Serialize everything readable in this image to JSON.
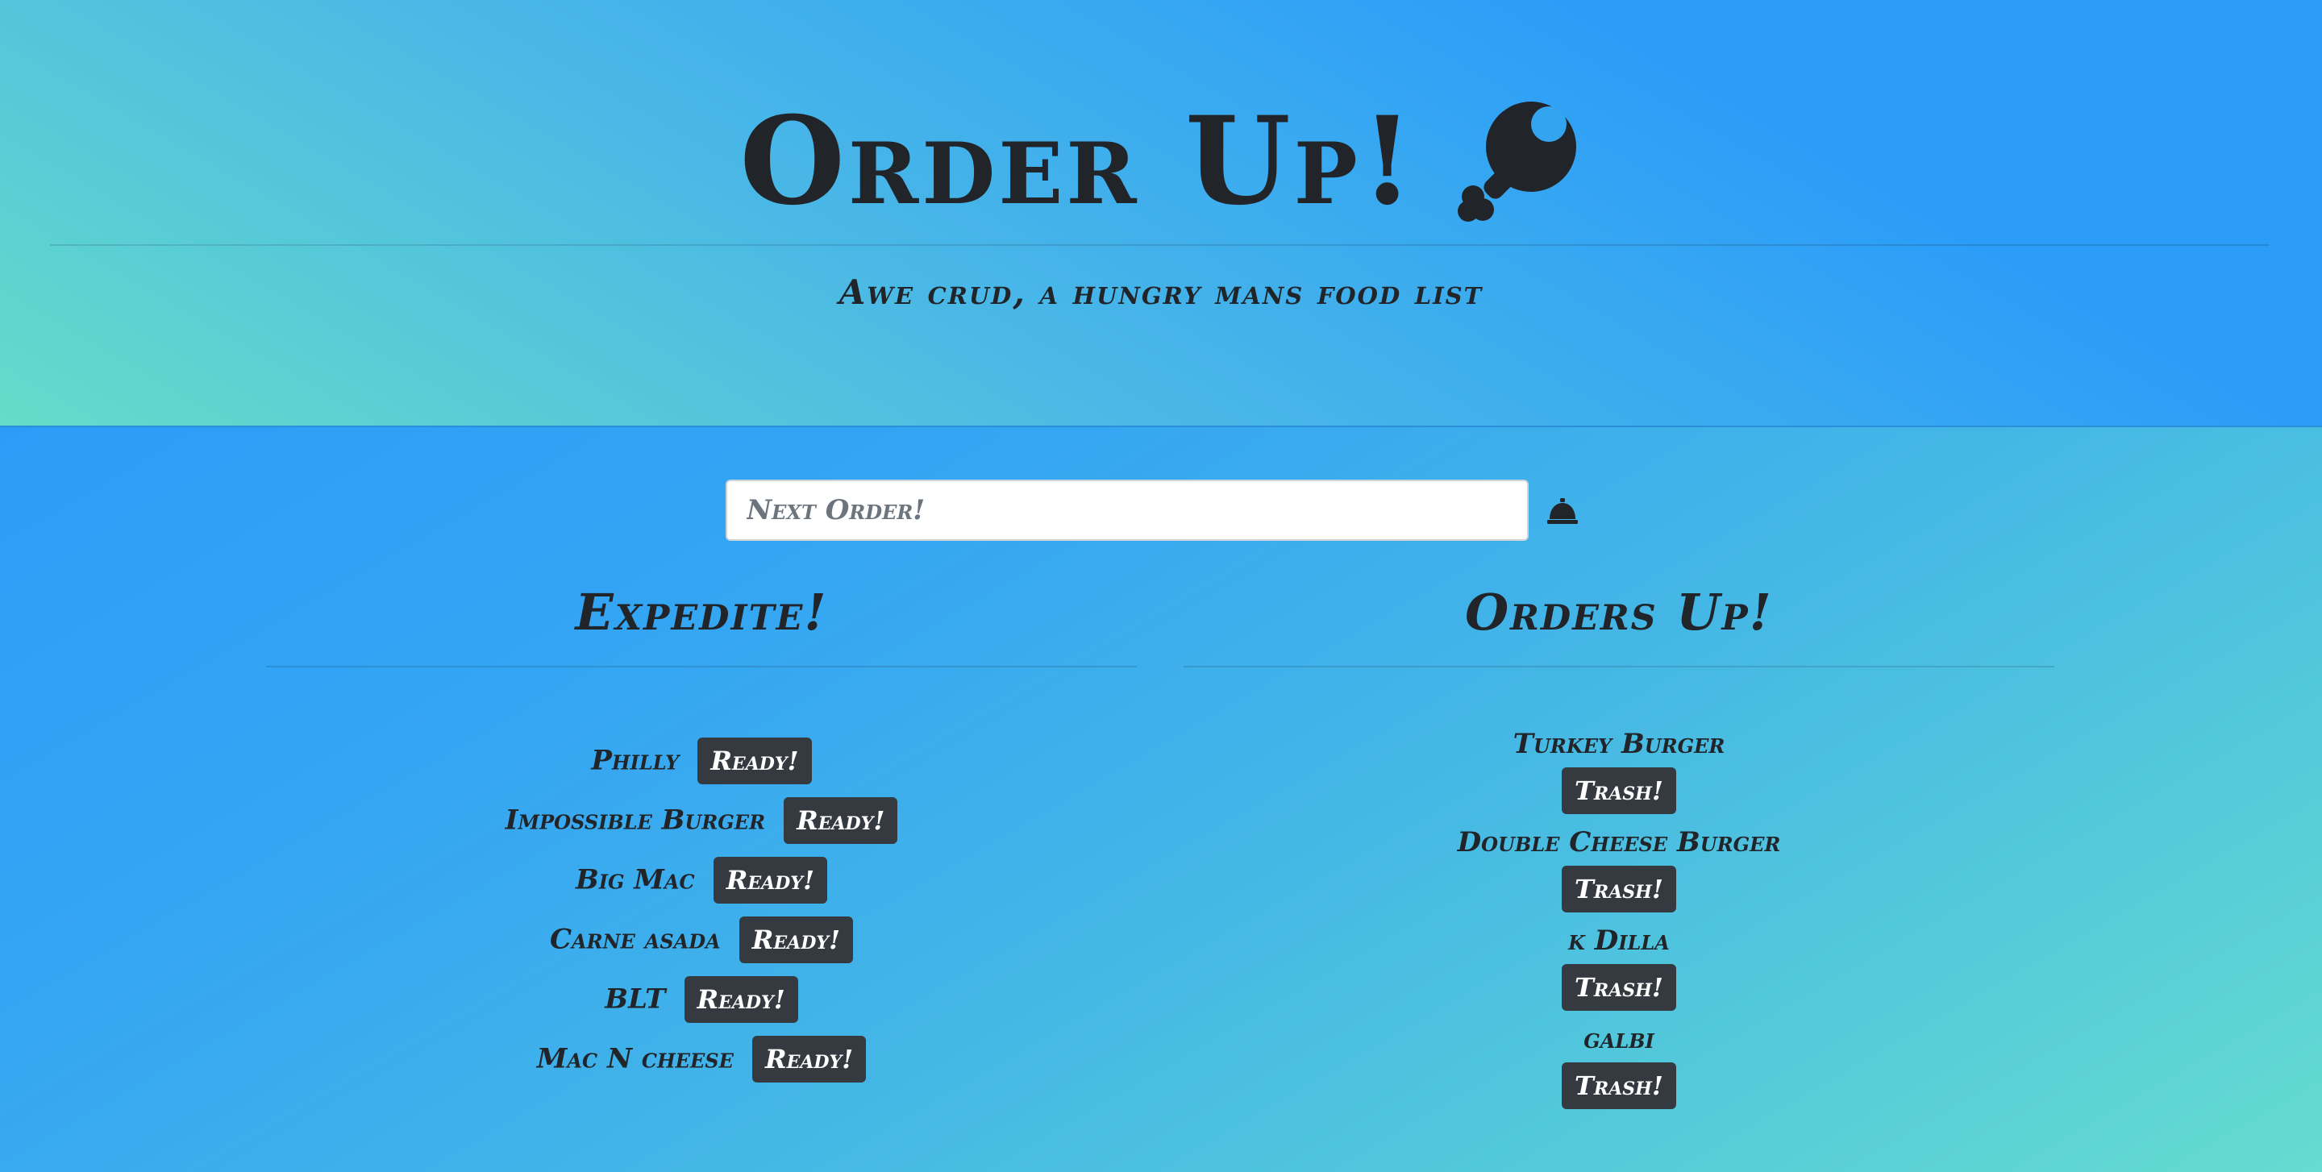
{
  "header": {
    "title": "Order Up!",
    "title_icon": "drumstick-icon",
    "subtitle": "Awe crud, a hungry mans food list"
  },
  "order_form": {
    "placeholder": "Next Order!",
    "value": "",
    "submit_icon": "bell-icon"
  },
  "expedite": {
    "heading": "Expedite!",
    "button_label": "Ready!",
    "items": [
      {
        "name": "Philly",
        "button": "Ready!"
      },
      {
        "name": "Impossible Burger",
        "button": "Ready!"
      },
      {
        "name": "Big Mac",
        "button": "Ready!"
      },
      {
        "name": "Carne asada",
        "button": "Ready!"
      },
      {
        "name": "BLT",
        "button": "Ready!"
      },
      {
        "name": "Mac N cheese",
        "button": "Ready!"
      }
    ]
  },
  "orders_up": {
    "heading": "Orders Up!",
    "button_label": "Trash!",
    "items": [
      {
        "name": "Turkey Burger",
        "button": "Trash!"
      },
      {
        "name": "Double Cheese Burger",
        "button": "Trash!"
      },
      {
        "name": "k Dilla",
        "button": "Trash!"
      },
      {
        "name": "galbi",
        "button": "Trash!"
      }
    ]
  },
  "colors": {
    "accent_blue": "#2b9df8",
    "accent_teal": "#64dcc9",
    "text_dark": "#212529",
    "button_dark": "#343a40"
  }
}
